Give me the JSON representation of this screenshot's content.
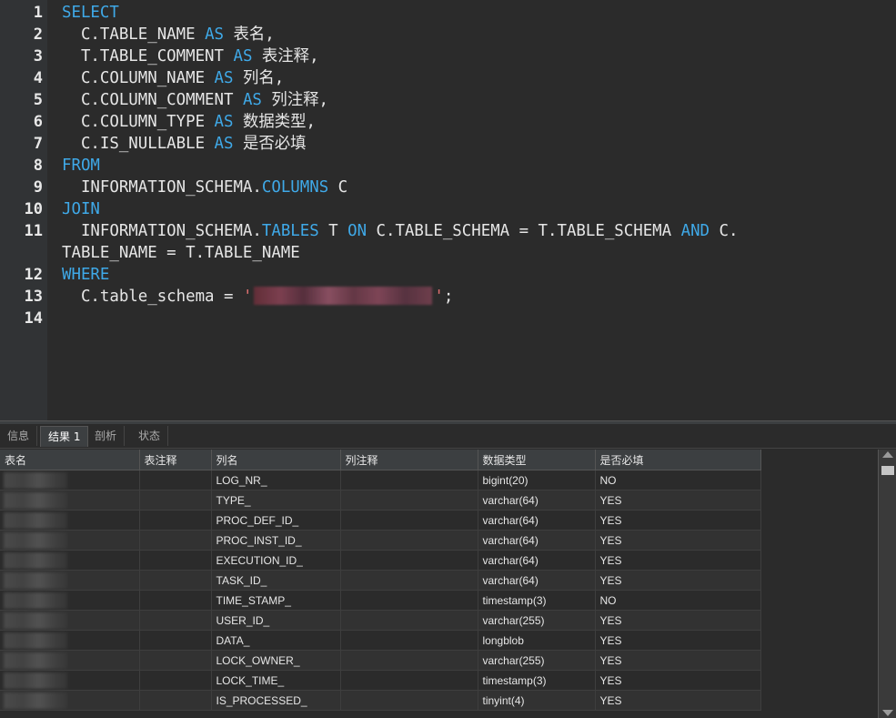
{
  "editor": {
    "line_numbers": [
      "1",
      "2",
      "3",
      "4",
      "5",
      "6",
      "7",
      "8",
      "9",
      "10",
      "11",
      "12",
      "13",
      "14"
    ],
    "lines": {
      "l1_kw": "SELECT",
      "l2_a": "  C.TABLE_NAME ",
      "l2_kw": "AS",
      "l2_b": " 表名,",
      "l3_a": "  T.TABLE_COMMENT ",
      "l3_kw": "AS",
      "l3_b": " 表注释,",
      "l4_a": "  C.COLUMN_NAME ",
      "l4_kw": "AS",
      "l4_b": " 列名,",
      "l5_a": "  C.COLUMN_COMMENT ",
      "l5_kw": "AS",
      "l5_b": " 列注释,",
      "l6_a": "  C.COLUMN_TYPE ",
      "l6_kw": "AS",
      "l6_b": " 数据类型,",
      "l7_a": "  C.IS_NULLABLE ",
      "l7_kw": "AS",
      "l7_b": " 是否必填",
      "l8_kw": "FROM",
      "l9_a": "  INFORMATION_SCHEMA.",
      "l9_obj": "COLUMNS",
      "l9_b": " C",
      "l10_kw": "JOIN",
      "l11_a": "  INFORMATION_SCHEMA.",
      "l11_obj": "TABLES",
      "l11_b": " T ",
      "l11_on": "ON",
      "l11_c": " C.TABLE_SCHEMA = T.TABLE_SCHEMA ",
      "l11_and": "AND",
      "l11_d": " C.",
      "l11_wrap": "TABLE_NAME = T.TABLE_NAME",
      "l12_kw": "WHERE",
      "l13_a": "  C.table_schema = ",
      "l13_q1": "'",
      "l13_q2": "'",
      "l13_end": ";"
    }
  },
  "tabs": [
    "信息",
    "结果 1",
    "剖析",
    "状态"
  ],
  "active_tab": "结果 1",
  "grid": {
    "columns": [
      "表名",
      "表注释",
      "列名",
      "列注释",
      "数据类型",
      "是否必填"
    ],
    "rows": [
      {
        "col_name": "LOG_NR_",
        "type": "bigint(20)",
        "nullable": "NO"
      },
      {
        "col_name": "TYPE_",
        "type": "varchar(64)",
        "nullable": "YES"
      },
      {
        "col_name": "PROC_DEF_ID_",
        "type": "varchar(64)",
        "nullable": "YES"
      },
      {
        "col_name": "PROC_INST_ID_",
        "type": "varchar(64)",
        "nullable": "YES"
      },
      {
        "col_name": "EXECUTION_ID_",
        "type": "varchar(64)",
        "nullable": "YES"
      },
      {
        "col_name": "TASK_ID_",
        "type": "varchar(64)",
        "nullable": "YES"
      },
      {
        "col_name": "TIME_STAMP_",
        "type": "timestamp(3)",
        "nullable": "NO"
      },
      {
        "col_name": "USER_ID_",
        "type": "varchar(255)",
        "nullable": "YES"
      },
      {
        "col_name": "DATA_",
        "type": "longblob",
        "nullable": "YES"
      },
      {
        "col_name": "LOCK_OWNER_",
        "type": "varchar(255)",
        "nullable": "YES"
      },
      {
        "col_name": "LOCK_TIME_",
        "type": "timestamp(3)",
        "nullable": "YES"
      },
      {
        "col_name": "IS_PROCESSED_",
        "type": "tinyint(4)",
        "nullable": "YES"
      }
    ]
  },
  "colors": {
    "keyword": "#3fa9e8",
    "editor_bg": "#2b2b2b",
    "gutter_bg": "#313335",
    "text": "#e6e6e6"
  }
}
